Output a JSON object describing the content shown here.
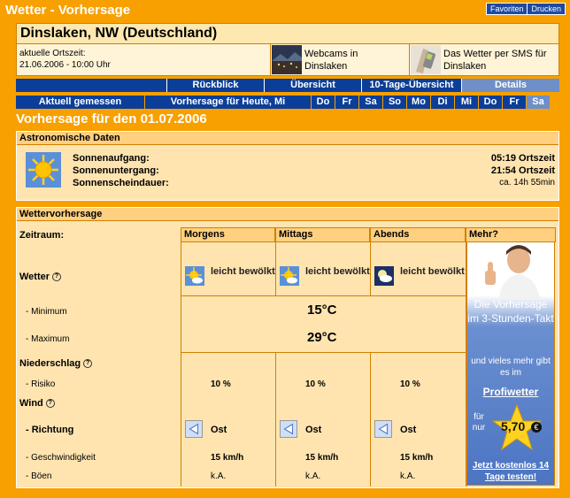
{
  "header": {
    "title": "Wetter - Vorhersage",
    "links": [
      "Favoriten",
      "Drucken"
    ]
  },
  "location": {
    "name": "Dinslaken, NW (Deutschland)",
    "time_label": "aktuelle Ortszeit:",
    "time_value": "21.06.2006 - 10:00 Uhr"
  },
  "promos": [
    {
      "label": "Webcams in Dinslaken"
    },
    {
      "label": "Das Wetter per SMS für Dinslaken"
    }
  ],
  "nav": {
    "items": [
      "Rückblick",
      "Übersicht",
      "10-Tage-Übersicht",
      "Details"
    ],
    "active": "Details"
  },
  "days": {
    "items": [
      "Aktuell gemessen",
      "Vorhersage für Heute, Mi",
      "Do",
      "Fr",
      "Sa",
      "So",
      "Mo",
      "Di",
      "Mi",
      "Do",
      "Fr",
      "Sa"
    ]
  },
  "forecast_title": "Vorhersage für den 01.07.2006",
  "astro": {
    "heading": "Astronomische Daten",
    "sunrise_label": "Sonnenaufgang:",
    "sunrise_value": "05:19 Ortszeit",
    "sunset_label": "Sonnenuntergang:",
    "sunset_value": "21:54 Ortszeit",
    "duration_label": "Sonnenscheindauer:",
    "duration_value": "ca. 14h 55min"
  },
  "weather": {
    "heading": "Wettervorhersage",
    "period_label": "Zeitraum:",
    "columns": [
      "Morgens",
      "Mittags",
      "Abends",
      "Mehr?"
    ],
    "rows": {
      "wetter": "Wetter",
      "minimum": "- Minimum",
      "maximum": "- Maximum",
      "niederschlag": "Niederschlag",
      "risiko": "- Risiko",
      "wind": "Wind",
      "richtung": "- Richtung",
      "geschwindigkeit": "- Geschwindigkeit",
      "boeen": "- Böen"
    },
    "conditions": [
      "leicht bewölkt",
      "leicht bewölkt",
      "leicht bewölkt"
    ],
    "min_temp": "15°C",
    "max_temp": "29°C",
    "risk": [
      "10 %",
      "10 %",
      "10 %"
    ],
    "direction": [
      "Ost",
      "Ost",
      "Ost"
    ],
    "speed": [
      "15 km/h",
      "15 km/h",
      "15 km/h"
    ],
    "gusts": [
      "k.A.",
      "k.A.",
      "k.A."
    ]
  },
  "ad": {
    "headline": "Die Vorhersage im 3-Stunden-Takt",
    "sub": "und vieles mehr gibt es im",
    "brand": "Profiwetter",
    "price_pre": "für nur",
    "price": "5,70",
    "currency": "€",
    "cta": "Jetzt kostenlos 14 Tage testen!"
  },
  "colors": {
    "frame": "#F8A000",
    "panel": "#FFE4B0",
    "nav": "#0B3E98",
    "nav_active": "#6F8FC8"
  }
}
